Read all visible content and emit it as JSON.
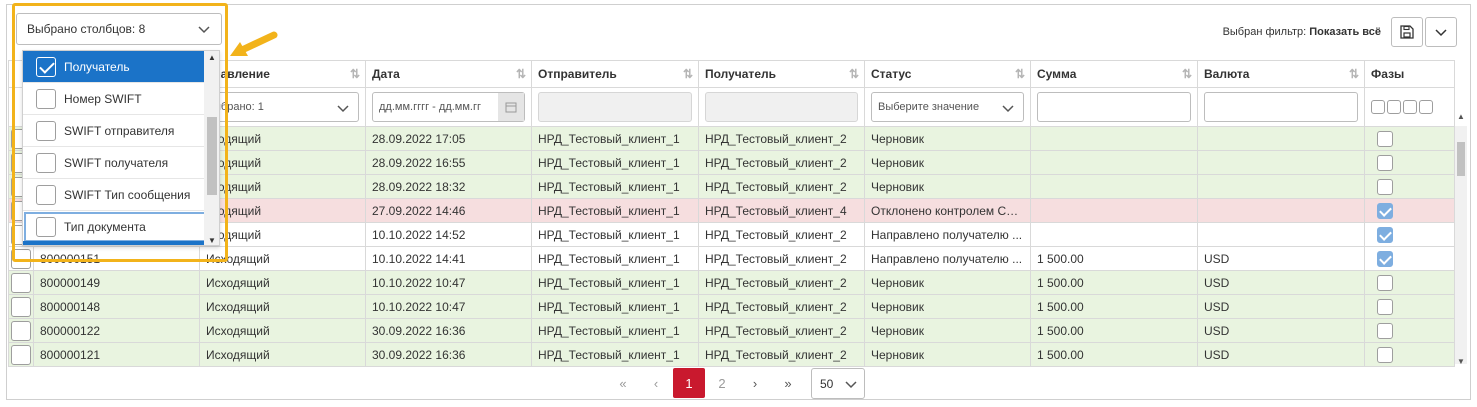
{
  "toolbar": {
    "columns_selected": "Выбрано столбцов: 8",
    "filter_label": "Выбран фильтр:",
    "filter_value": "Показать всё"
  },
  "columns": [
    "Направление",
    "Дата",
    "Отправитель",
    "Получатель",
    "Статус",
    "Сумма",
    "Валюта",
    "Фазы"
  ],
  "column_header_partial": "правление",
  "filters": {
    "direction_value": "ыбрано: 1",
    "date_placeholder": "дд.мм.гггг - дд.мм.гг",
    "status_placeholder": "Выберите значение"
  },
  "rows": [
    {
      "id": "",
      "direction": "сходящий",
      "date": "28.09.2022 17:05",
      "sender": "НРД_Тестовый_клиент_1",
      "receiver": "НРД_Тестовый_клиент_2",
      "status": "Черновик",
      "sum": "",
      "currency": "",
      "phase": false,
      "color": "green"
    },
    {
      "id": "",
      "direction": "сходящий",
      "date": "28.09.2022 16:55",
      "sender": "НРД_Тестовый_клиент_1",
      "receiver": "НРД_Тестовый_клиент_2",
      "status": "Черновик",
      "sum": "",
      "currency": "",
      "phase": false,
      "color": "green"
    },
    {
      "id": "",
      "direction": "сходящий",
      "date": "28.09.2022 18:32",
      "sender": "НРД_Тестовый_клиент_1",
      "receiver": "НРД_Тестовый_клиент_2",
      "status": "Черновик",
      "sum": "",
      "currency": "",
      "phase": false,
      "color": "green"
    },
    {
      "id": "",
      "direction": "сходящий",
      "date": "27.09.2022 14:46",
      "sender": "НРД_Тестовый_клиент_1",
      "receiver": "НРД_Тестовый_клиент_4",
      "status": "Отклонено контролем СП...",
      "sum": "",
      "currency": "",
      "phase": true,
      "color": "red"
    },
    {
      "id": "",
      "direction": "сходящий",
      "date": "10.10.2022 14:52",
      "sender": "НРД_Тестовый_клиент_1",
      "receiver": "НРД_Тестовый_клиент_2",
      "status": "Направлено получателю ...",
      "sum": "",
      "currency": "",
      "phase": true,
      "color": "white"
    },
    {
      "id": "800000151",
      "direction": "Исходящий",
      "date": "10.10.2022 14:41",
      "sender": "НРД_Тестовый_клиент_1",
      "receiver": "НРД_Тестовый_клиент_2",
      "status": "Направлено получателю ...",
      "sum": "1 500.00",
      "currency": "USD",
      "phase": true,
      "color": "white"
    },
    {
      "id": "800000149",
      "direction": "Исходящий",
      "date": "10.10.2022 10:47",
      "sender": "НРД_Тестовый_клиент_1",
      "receiver": "НРД_Тестовый_клиент_2",
      "status": "Черновик",
      "sum": "1 500.00",
      "currency": "USD",
      "phase": false,
      "color": "green"
    },
    {
      "id": "800000148",
      "direction": "Исходящий",
      "date": "10.10.2022 10:47",
      "sender": "НРД_Тестовый_клиент_1",
      "receiver": "НРД_Тестовый_клиент_2",
      "status": "Черновик",
      "sum": "1 500.00",
      "currency": "USD",
      "phase": false,
      "color": "green"
    },
    {
      "id": "800000122",
      "direction": "Исходящий",
      "date": "30.09.2022 16:36",
      "sender": "НРД_Тестовый_клиент_1",
      "receiver": "НРД_Тестовый_клиент_2",
      "status": "Черновик",
      "sum": "1 500.00",
      "currency": "USD",
      "phase": false,
      "color": "green"
    },
    {
      "id": "800000121",
      "direction": "Исходящий",
      "date": "30.09.2022 16:36",
      "sender": "НРД_Тестовый_клиент_1",
      "receiver": "НРД_Тестовый_клиент_2",
      "status": "Черновик",
      "sum": "1 500.00",
      "currency": "USD",
      "phase": false,
      "color": "green"
    }
  ],
  "dropdown": {
    "items": [
      {
        "label": "Получатель",
        "checked": true
      },
      {
        "label": "Номер SWIFT",
        "checked": false
      },
      {
        "label": "SWIFT отправителя",
        "checked": false
      },
      {
        "label": "SWIFT получателя",
        "checked": false
      },
      {
        "label": "SWIFT Тип сообщения",
        "checked": false
      },
      {
        "label": "Тип документа",
        "checked": false
      }
    ]
  },
  "pagination": {
    "pages": [
      "1",
      "2"
    ],
    "current": "1",
    "page_size": "50"
  },
  "colors": {
    "accent": "#1b73c8",
    "highlight_border": "#f2b31b",
    "active_page": "#c9192e",
    "row_green": "#e9f4e0",
    "row_red": "#f6dedf"
  }
}
